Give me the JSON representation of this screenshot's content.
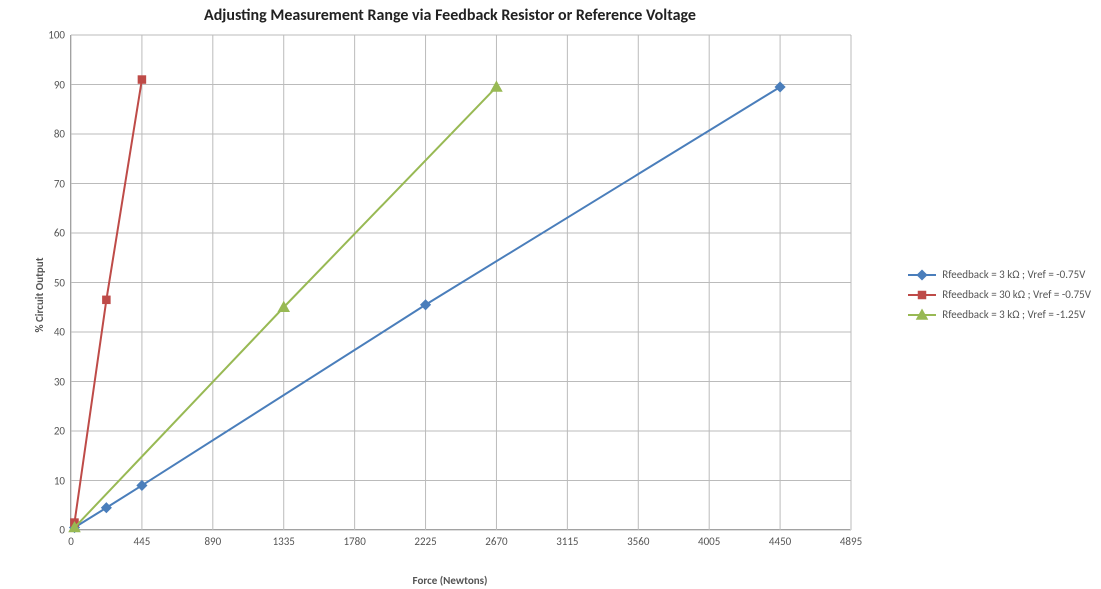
{
  "chart_data": {
    "type": "line",
    "title": "Adjusting Measurement Range via Feedback Resistor or Reference Voltage",
    "xlabel": "Force (Newtons)",
    "ylabel": "% Circuit Output",
    "xlim": [
      0,
      4895
    ],
    "ylim": [
      0,
      100
    ],
    "x_ticks": [
      0,
      445,
      890,
      1335,
      1780,
      2225,
      2670,
      3115,
      3560,
      4005,
      4450,
      4895
    ],
    "y_ticks": [
      0,
      10,
      20,
      30,
      40,
      50,
      60,
      70,
      80,
      90,
      100
    ],
    "series": [
      {
        "name": "Rfeedback = 3 kΩ ; Vref = -0.75V",
        "color": "#4a7ebb",
        "marker": "diamond",
        "x": [
          22,
          222,
          445,
          2225,
          4450
        ],
        "y": [
          0.5,
          4.5,
          9,
          45.5,
          89.5
        ]
      },
      {
        "name": "Rfeedback = 30 kΩ ; Vref = -0.75V",
        "color": "#be4b48",
        "marker": "square",
        "x": [
          22,
          222,
          445
        ],
        "y": [
          1.5,
          46.5,
          91
        ]
      },
      {
        "name": "Rfeedback = 3 kΩ ; Vref = -1.25V",
        "color": "#98b954",
        "marker": "triangle",
        "x": [
          22,
          1335,
          2670
        ],
        "y": [
          0.5,
          45,
          89.5
        ]
      }
    ]
  }
}
